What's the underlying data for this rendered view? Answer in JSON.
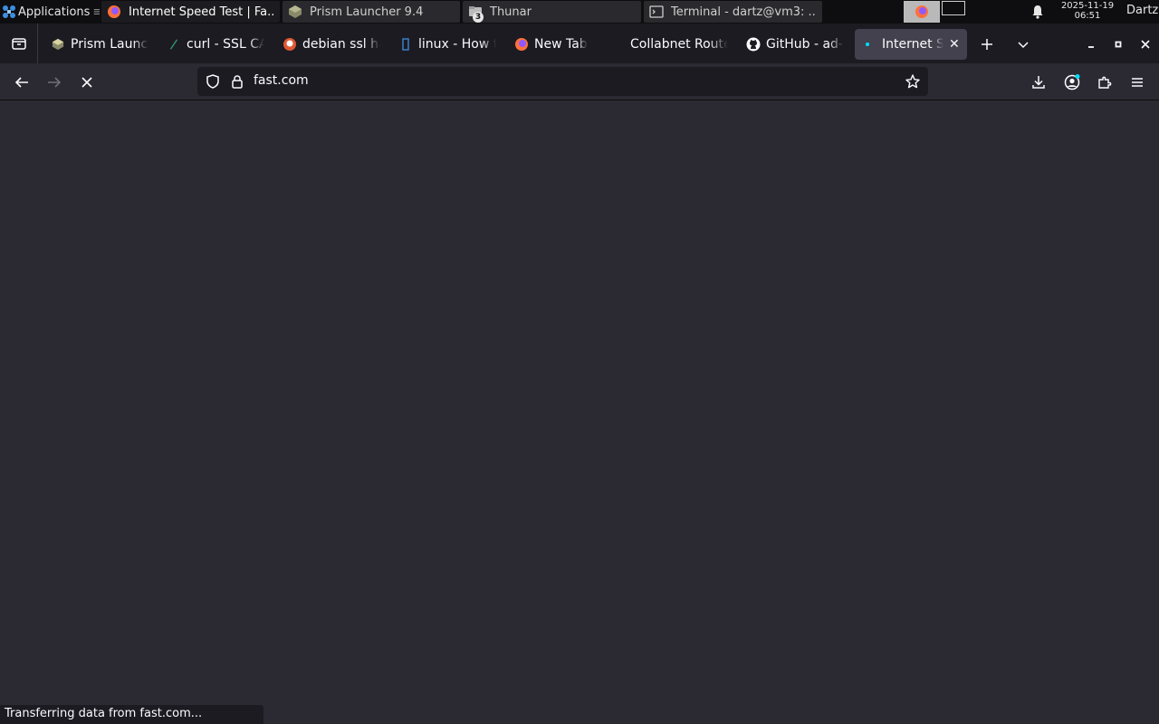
{
  "panel": {
    "apps_label": "Applications",
    "windows": [
      {
        "title": "Internet Speed Test | Fa...",
        "icon": "firefox-icon",
        "state": "active"
      },
      {
        "title": "Prism Launcher 9.4",
        "icon": "prism-launcher-icon",
        "state": "inactive"
      },
      {
        "title": "Thunar",
        "icon": "folder-icon",
        "state": "inactive",
        "badge": "3"
      },
      {
        "title": "Terminal - dartz@vm3: ...",
        "icon": "terminal-icon",
        "state": "inactive"
      }
    ],
    "clock_date": "2025-11-19",
    "clock_time": "06:51",
    "user": "Dartz"
  },
  "browser": {
    "tabs": [
      {
        "label": "Prism Launcher",
        "icon": "prism-launcher-icon"
      },
      {
        "label": "curl - SSL CA",
        "icon": "stackexchange-icon"
      },
      {
        "label": "debian ssl ha",
        "icon": "duckduckgo-icon"
      },
      {
        "label": "linux - How t",
        "icon": "unix-stackexchange-icon"
      },
      {
        "label": "New Tab",
        "icon": "firefox-icon"
      },
      {
        "label": "Collabnet Route",
        "icon": "blank-page-icon"
      },
      {
        "label": "GitHub - ad-c",
        "icon": "github-icon"
      },
      {
        "label": "Internet Sp",
        "icon": "loading-dot-icon",
        "selected": true
      }
    ],
    "url": "fast.com",
    "status_text": "Transferring data from fast.com..."
  },
  "colors": {
    "toolbar_bg": "#2b2a33",
    "tabbar_bg": "#1c1b22",
    "selected_tab_bg": "#42414d",
    "panel_bg": "#0e0e10",
    "loading_accent": "#0df"
  }
}
